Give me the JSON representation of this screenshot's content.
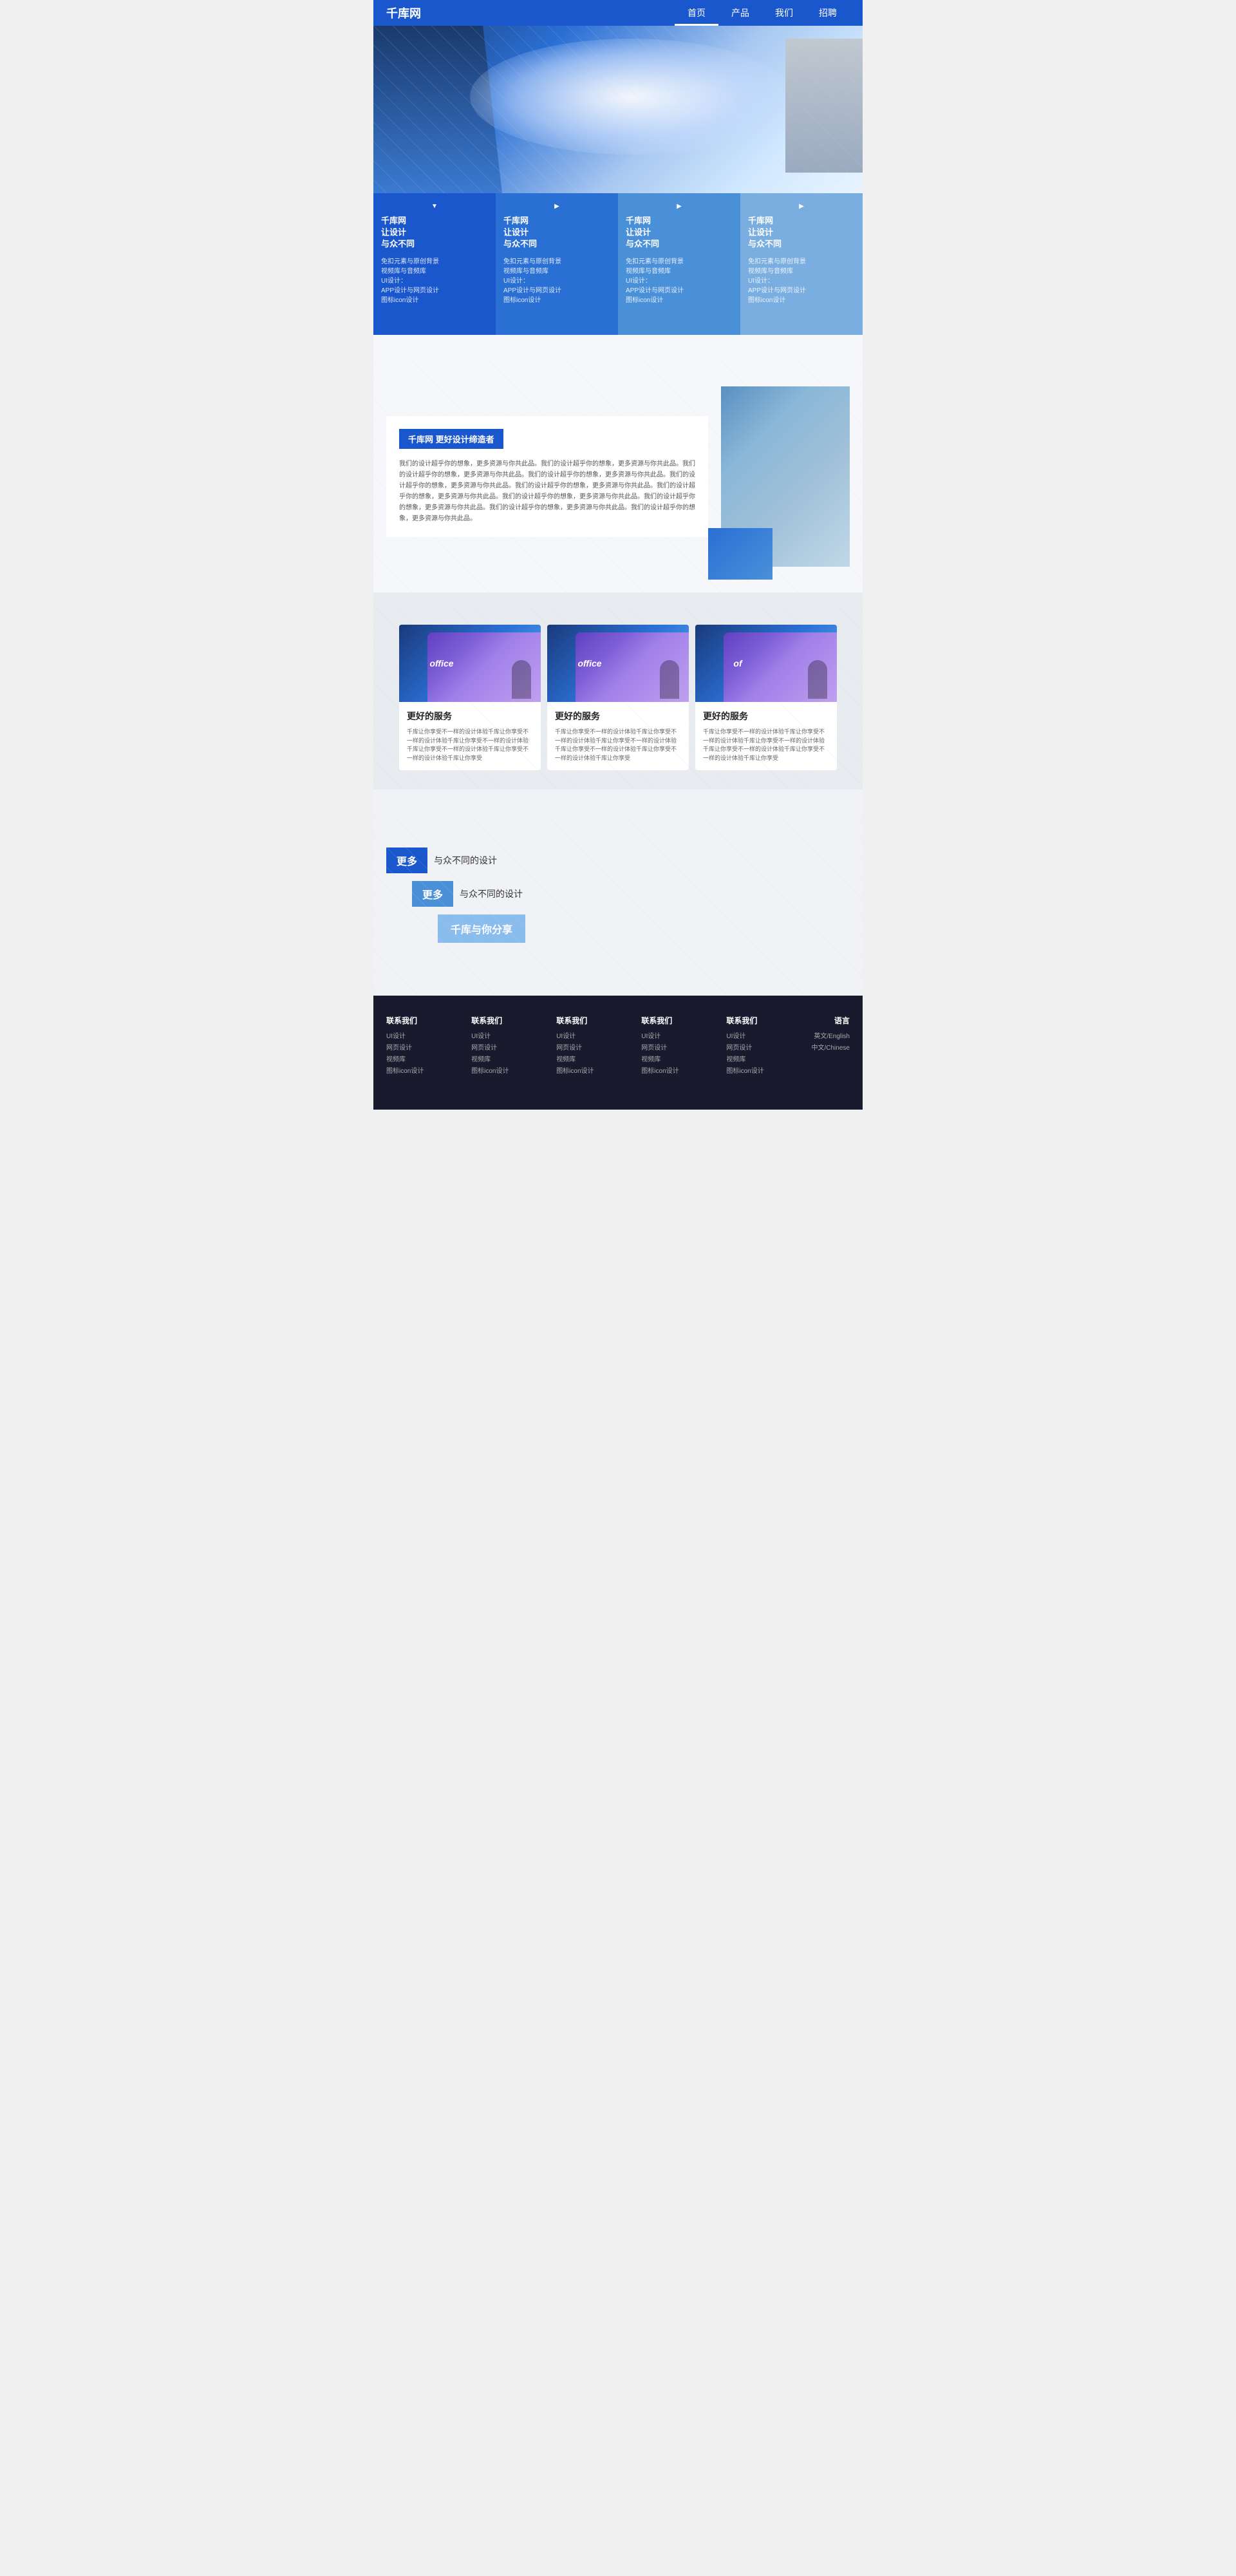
{
  "navbar": {
    "logo": "千库网",
    "nav_items": [
      {
        "label": "首页",
        "active": true
      },
      {
        "label": "产品",
        "active": false
      },
      {
        "label": "我们",
        "active": false
      },
      {
        "label": "招聘",
        "active": false
      }
    ]
  },
  "feature_cards": [
    {
      "title": "千库网\n让设计\n与众不同",
      "desc": "免扣元素与原创背景\n视频库与音频库\nUI设计：\nAPP设计与网页设计\n图标icon设计"
    },
    {
      "title": "千库网\n让设计\n与众不同",
      "desc": "免扣元素与原创背景\n视频库与音频库\nUI设计：\nAPP设计与网页设计\n图标icon设计"
    },
    {
      "title": "千库网\n让设计\n与众不同",
      "desc": "免扣元素与原创背景\n视频库与音频库\nUI设计：\nAPP设计与网页设计\n图标icon设计"
    },
    {
      "title": "千库网\n让设计\n与众不同",
      "desc": "免扣元素与原创背景\n视频库与音频库\nUI设计：\nAPP设计与网页设计\n图标icon设计"
    }
  ],
  "about": {
    "tag": "千库网  更好设计缔造者",
    "desc": "我们的设计超乎你的想象，更多资源与你共此品。我们的设计超乎你的想象，更多资源与你共此品。我们的设计超乎你的想象，更多资源与你共此品。我们的设计超乎你的想象，更多资源与你共此品。我们的设计超乎你的想象，更多资源与你共此品。我们的设计超乎你的想象，更多资源与你共此品。我们的设计超乎你的想象，更多资源与你共此品。我们的设计超乎你的想象，更多资源与你共此品。我们的设计超乎你的想象，更多资源与你共此品。我们的设计超乎你的想象，更多资源与你共此品。我们的设计超乎你的想象，更多资源与你共此品。"
  },
  "services": [
    {
      "office_label": "office",
      "title": "更好的服务",
      "desc": "千库让你享受不一样的设计体验千库让你享受不一样的设计体验千库让你享受不一样的设计体验千库让你享受不一样的设计体验千库让你享受不一样的设计体验千库让你享受"
    },
    {
      "office_label": "office",
      "title": "更好的服务",
      "desc": "千库让你享受不一样的设计体验千库让你享受不一样的设计体验千库让你享受不一样的设计体验千库让你享受不一样的设计体验千库让你享受不一样的设计体验千库让你享受"
    },
    {
      "office_label": "of",
      "title": "更好的服务",
      "desc": "千库让你享受不一样的设计体验千库让你享受不一样的设计体验千库让你享受不一样的设计体验千库让你享受不一样的设计体验千库让你享受不一样的设计体验千库让你享受"
    }
  ],
  "design": {
    "row1_box": "更多",
    "row1_label": "与众不同的设计",
    "row2_box": "更多",
    "row2_label": "与众不同的设计",
    "row3_label": "千库与你分享"
  },
  "footer": {
    "columns": [
      {
        "title": "联系我们",
        "items": [
          "UI设计",
          "网页设计",
          "视频库",
          "图标icon设计"
        ]
      },
      {
        "title": "联系我们",
        "items": [
          "UI设计",
          "网页设计",
          "视频库",
          "图标icon设计"
        ]
      },
      {
        "title": "联系我们",
        "items": [
          "UI设计",
          "网页设计",
          "视频库",
          "图标icon设计"
        ]
      },
      {
        "title": "联系我们",
        "items": [
          "UI设计",
          "网页设计",
          "视频库",
          "图标icon设计"
        ]
      },
      {
        "title": "联系我们",
        "items": [
          "UI设计",
          "网页设计",
          "视频库",
          "图标icon设计"
        ]
      }
    ],
    "lang_title": "语言",
    "lang_items": [
      "英文/English",
      "中文/Chinese"
    ]
  }
}
